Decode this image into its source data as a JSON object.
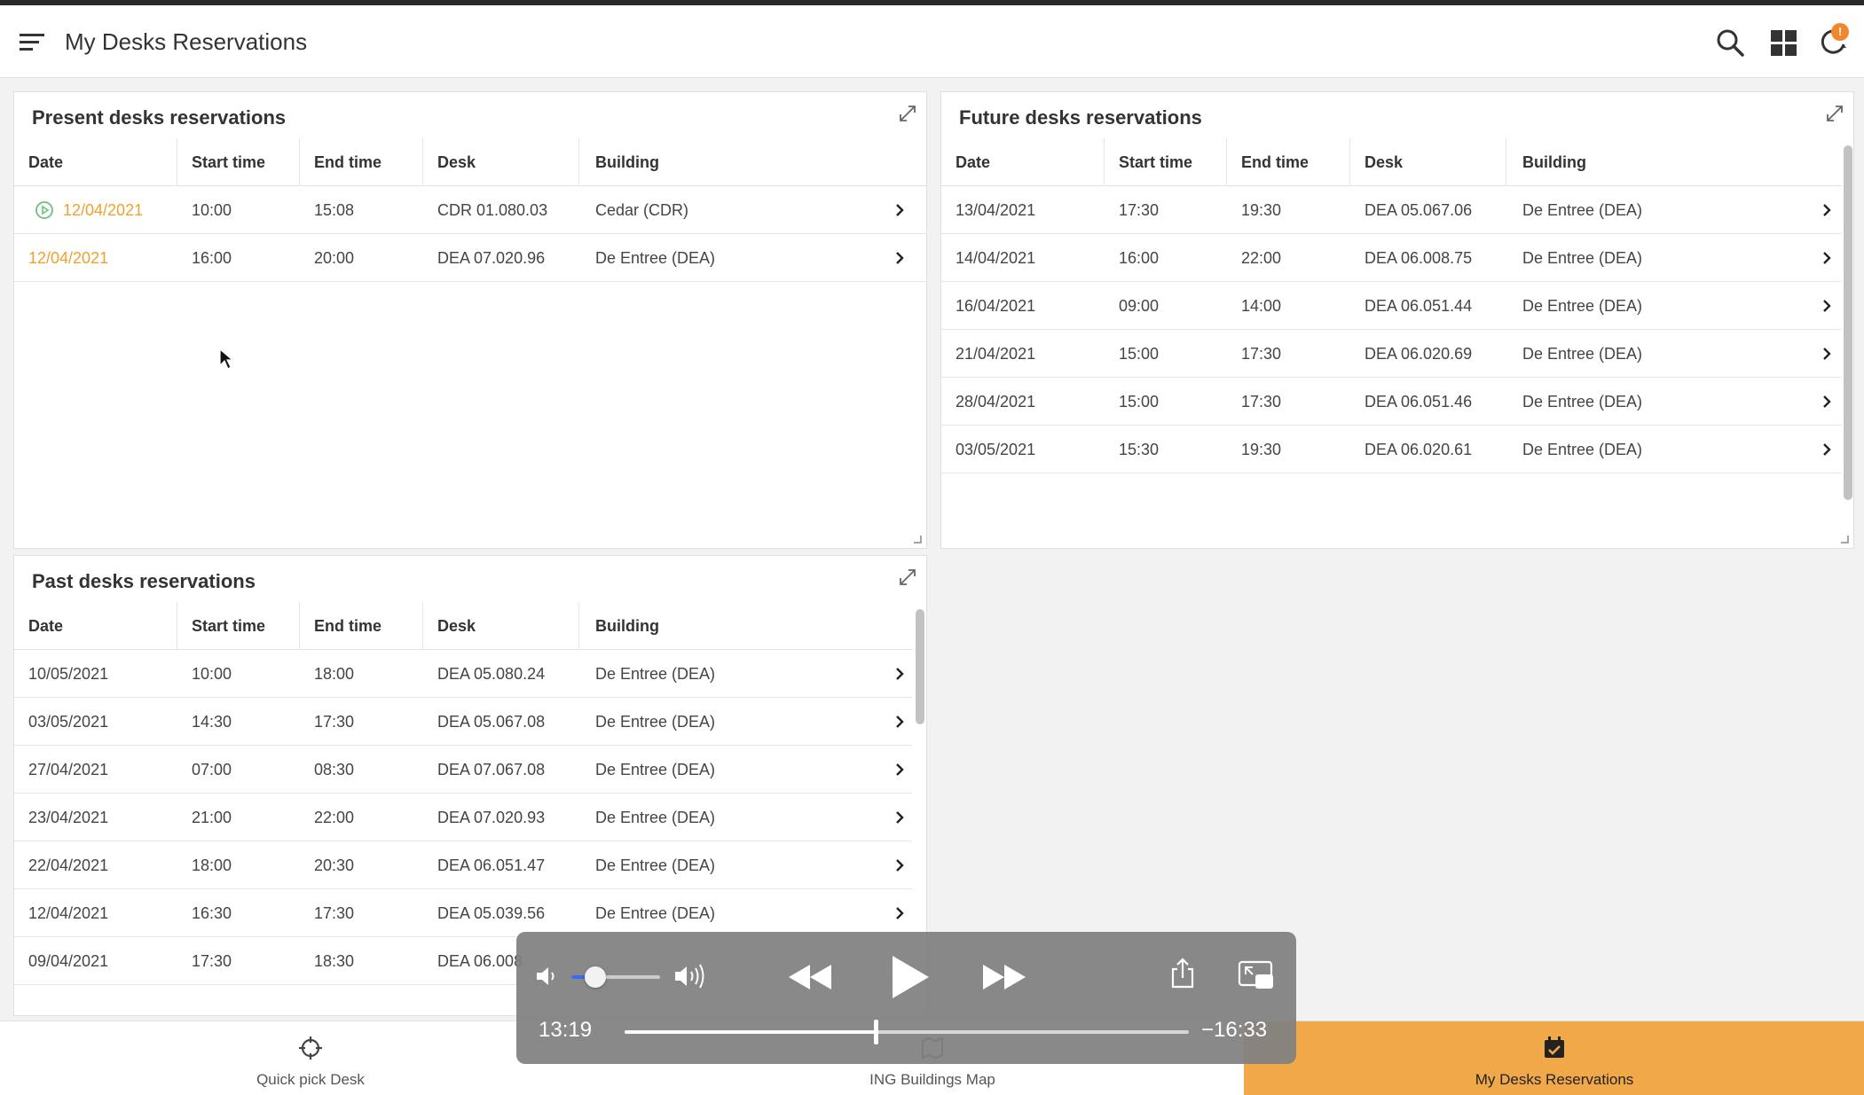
{
  "header": {
    "title": "My Desks Reservations"
  },
  "columns": [
    "Date",
    "Start time",
    "End time",
    "Desk",
    "Building"
  ],
  "present": {
    "title": "Present desks reservations",
    "rows": [
      {
        "date": "12/04/2021",
        "start": "10:00",
        "end": "15:08",
        "desk": "CDR 01.080.03",
        "building": "Cedar (CDR)"
      },
      {
        "date": "12/04/2021",
        "start": "16:00",
        "end": "20:00",
        "desk": "DEA 07.020.96",
        "building": "De Entree (DEA)"
      }
    ]
  },
  "future": {
    "title": "Future desks reservations",
    "rows": [
      {
        "date": "13/04/2021",
        "start": "17:30",
        "end": "19:30",
        "desk": "DEA 05.067.06",
        "building": "De Entree (DEA)"
      },
      {
        "date": "14/04/2021",
        "start": "16:00",
        "end": "22:00",
        "desk": "DEA 06.008.75",
        "building": "De Entree (DEA)"
      },
      {
        "date": "16/04/2021",
        "start": "09:00",
        "end": "14:00",
        "desk": "DEA 06.051.44",
        "building": "De Entree (DEA)"
      },
      {
        "date": "21/04/2021",
        "start": "15:00",
        "end": "17:30",
        "desk": "DEA 06.020.69",
        "building": "De Entree (DEA)"
      },
      {
        "date": "28/04/2021",
        "start": "15:00",
        "end": "17:30",
        "desk": "DEA 06.051.46",
        "building": "De Entree (DEA)"
      },
      {
        "date": "03/05/2021",
        "start": "15:30",
        "end": "19:30",
        "desk": "DEA 06.020.61",
        "building": "De Entree (DEA)"
      }
    ]
  },
  "past": {
    "title": "Past desks reservations",
    "rows": [
      {
        "date": "10/05/2021",
        "start": "10:00",
        "end": "18:00",
        "desk": "DEA 05.080.24",
        "building": "De Entree (DEA)"
      },
      {
        "date": "03/05/2021",
        "start": "14:30",
        "end": "17:30",
        "desk": "DEA 05.067.08",
        "building": "De Entree (DEA)"
      },
      {
        "date": "27/04/2021",
        "start": "07:00",
        "end": "08:30",
        "desk": "DEA 07.067.08",
        "building": "De Entree (DEA)"
      },
      {
        "date": "23/04/2021",
        "start": "21:00",
        "end": "22:00",
        "desk": "DEA 07.020.93",
        "building": "De Entree (DEA)"
      },
      {
        "date": "22/04/2021",
        "start": "18:00",
        "end": "20:30",
        "desk": "DEA 06.051.47",
        "building": "De Entree (DEA)"
      },
      {
        "date": "12/04/2021",
        "start": "16:30",
        "end": "17:30",
        "desk": "DEA 05.039.56",
        "building": "De Entree (DEA)"
      },
      {
        "date": "09/04/2021",
        "start": "17:30",
        "end": "18:30",
        "desk": "DEA 06.008",
        "building": ""
      }
    ]
  },
  "bottom_nav": [
    {
      "label": "Quick pick Desk",
      "icon": "crosshair-icon"
    },
    {
      "label": "ING Buildings Map",
      "icon": "map-icon"
    },
    {
      "label": "My Desks Reservations",
      "icon": "calendar-check-icon"
    }
  ],
  "player": {
    "elapsed": "13:19",
    "remaining": "−16:33",
    "progress": 0.445,
    "volume": 0.27
  },
  "colors": {
    "accent_orange": "#f0a848",
    "today_date": "#f0a02d",
    "badge": "#f0872d",
    "volume_blue": "#3a6cf0"
  }
}
